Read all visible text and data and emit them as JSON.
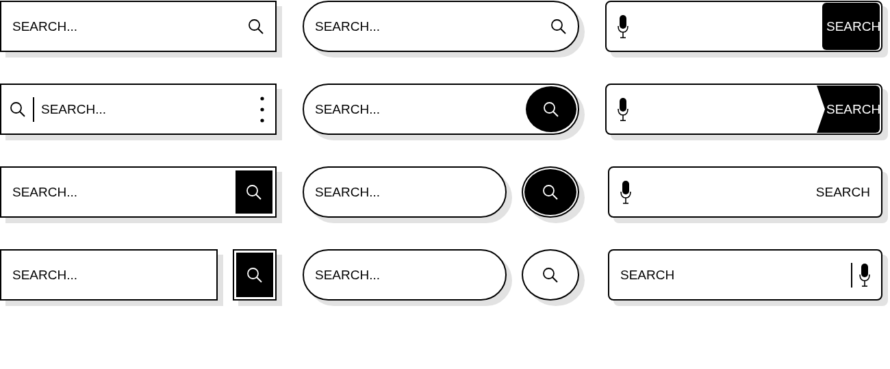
{
  "search_bars": [
    {
      "kind": "rect-icon-right",
      "placeholder": "SEARCH..."
    },
    {
      "kind": "pill-icon-right",
      "placeholder": "SEARCH..."
    },
    {
      "kind": "mic-button",
      "button": "SEARCH"
    },
    {
      "kind": "rect-icon-left-menu",
      "placeholder": "SEARCH..."
    },
    {
      "kind": "pill-inset-button",
      "placeholder": "SEARCH..."
    },
    {
      "kind": "mic-chevron-button",
      "button": "SEARCH"
    },
    {
      "kind": "rect-inset-button",
      "placeholder": "SEARCH..."
    },
    {
      "kind": "pill-separate-button",
      "placeholder": "SEARCH...",
      "button_filled": true
    },
    {
      "kind": "mic-label",
      "button": "SEARCH"
    },
    {
      "kind": "rect-separate-button",
      "placeholder": "SEARCH...",
      "button_filled": true
    },
    {
      "kind": "pill-separate-button",
      "placeholder": "SEARCH...",
      "button_filled": false
    },
    {
      "kind": "mic-right",
      "placeholder": "SEARCH"
    }
  ]
}
